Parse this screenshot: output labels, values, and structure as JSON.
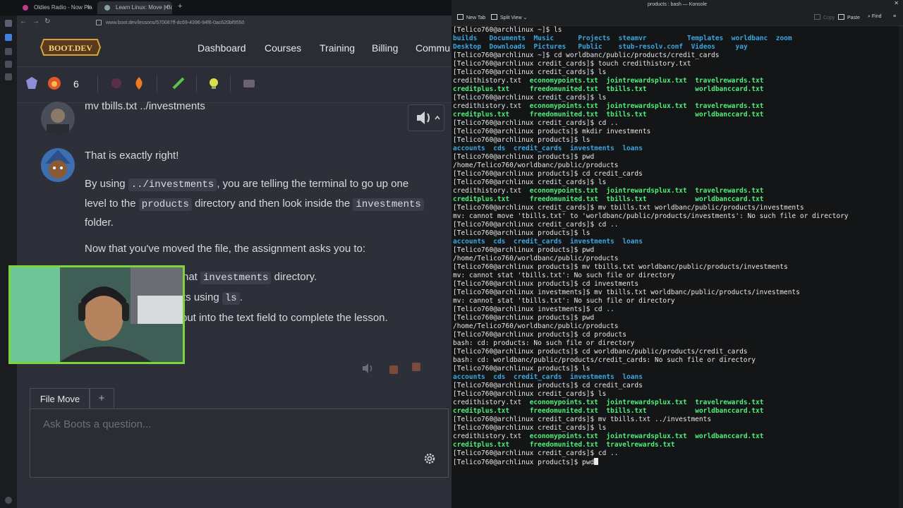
{
  "browser": {
    "tabs": [
      {
        "label": "Oldies Radio - Now Pla",
        "favicon_color": "#c23b8f"
      },
      {
        "label": "Learn Linux: Move | Boot.",
        "favicon_color": "#8a9ca8"
      }
    ],
    "url": "www.boot.dev/lessons/570087ff-dc69-4396-94f6-0ac620bf9550"
  },
  "site": {
    "logo": "BOOT.DEV",
    "nav": [
      "Dashboard",
      "Courses",
      "Training",
      "Billing",
      "Commu"
    ],
    "streak": "6"
  },
  "chat": {
    "user_message": "mv tbills.txt ../investments",
    "bot_line1": "That is exactly right!",
    "bot_p2_a": "By using ",
    "bot_p2_code1": "../investments",
    "bot_p2_b": ", you are telling the terminal to go up one level to the ",
    "bot_p2_code2": "products",
    "bot_p2_c": " directory and then look inside the ",
    "bot_p2_code3": "investments",
    "bot_p2_d": " folder.",
    "bot_p3": "Now that you've moved the file, the assignment asks you to:",
    "bot_li1_a": "hat ",
    "bot_li1_code": "investments",
    "bot_li1_b": " directory.",
    "bot_li2_a": "ts using ",
    "bot_li2_code": "ls",
    "bot_li2_b": ".",
    "bot_li3": "put into the text field to complete the lesson."
  },
  "input": {
    "tab_label": "File Move",
    "add_label": "+",
    "placeholder": "Ask Boots a question..."
  },
  "konsole": {
    "title": "products : bash — Konsole",
    "toolbar": {
      "new_tab": "New Tab",
      "split_view": "Split View",
      "copy": "Copy",
      "paste": "Paste",
      "find": "Find"
    },
    "lines": [
      [
        [
          "p",
          "[Telico760@archlinux ~]$ ls"
        ]
      ],
      [
        [
          "d",
          "builds"
        ],
        [
          "p",
          "   "
        ],
        [
          "d",
          "Documents"
        ],
        [
          "p",
          "  "
        ],
        [
          "d",
          "Music"
        ],
        [
          "p",
          "      "
        ],
        [
          "d",
          "Projects"
        ],
        [
          "p",
          "  "
        ],
        [
          "d",
          "steamvr"
        ],
        [
          "p",
          "          "
        ],
        [
          "d",
          "Templates"
        ],
        [
          "p",
          "  "
        ],
        [
          "d",
          "worldbanc"
        ],
        [
          "p",
          "  "
        ],
        [
          "d",
          "zoom"
        ]
      ],
      [
        [
          "d",
          "Desktop"
        ],
        [
          "p",
          "  "
        ],
        [
          "d",
          "Downloads"
        ],
        [
          "p",
          "  "
        ],
        [
          "d",
          "Pictures"
        ],
        [
          "p",
          "   "
        ],
        [
          "d",
          "Public"
        ],
        [
          "p",
          "    "
        ],
        [
          "d",
          "stub-resolv.conf"
        ],
        [
          "p",
          "  "
        ],
        [
          "d",
          "Videos"
        ],
        [
          "p",
          "     "
        ],
        [
          "d",
          "yay"
        ]
      ],
      [
        [
          "p",
          "[Telico760@archlinux ~]$ cd worldbanc/public/products/credit_cards"
        ]
      ],
      [
        [
          "p",
          "[Telico760@archlinux credit_cards]$ touch credithistory.txt"
        ]
      ],
      [
        [
          "p",
          "[Telico760@archlinux credit_cards]$ ls"
        ]
      ],
      [
        [
          "p",
          "credithistory.txt  "
        ],
        [
          "f",
          "economypoints.txt"
        ],
        [
          "p",
          "  "
        ],
        [
          "f",
          "jointrewardsplux.txt"
        ],
        [
          "p",
          "  "
        ],
        [
          "f",
          "travelrewards.txt"
        ]
      ],
      [
        [
          "f",
          "creditplus.txt"
        ],
        [
          "p",
          "     "
        ],
        [
          "f",
          "freedomunited.txt"
        ],
        [
          "p",
          "  "
        ],
        [
          "f",
          "tbills.txt"
        ],
        [
          "p",
          "            "
        ],
        [
          "f",
          "worldbanccard.txt"
        ]
      ],
      [
        [
          "p",
          "[Telico760@archlinux credit_cards]$ ls"
        ]
      ],
      [
        [
          "p",
          "credithistory.txt  "
        ],
        [
          "f",
          "economypoints.txt"
        ],
        [
          "p",
          "  "
        ],
        [
          "f",
          "jointrewardsplux.txt"
        ],
        [
          "p",
          "  "
        ],
        [
          "f",
          "travelrewards.txt"
        ]
      ],
      [
        [
          "f",
          "creditplus.txt"
        ],
        [
          "p",
          "     "
        ],
        [
          "f",
          "freedomunited.txt"
        ],
        [
          "p",
          "  "
        ],
        [
          "f",
          "tbills.txt"
        ],
        [
          "p",
          "            "
        ],
        [
          "f",
          "worldbanccard.txt"
        ]
      ],
      [
        [
          "p",
          "[Telico760@archlinux credit_cards]$ cd .."
        ]
      ],
      [
        [
          "p",
          "[Telico760@archlinux products]$ mkdir investments"
        ]
      ],
      [
        [
          "p",
          "[Telico760@archlinux products]$ ls"
        ]
      ],
      [
        [
          "d",
          "accounts"
        ],
        [
          "p",
          "  "
        ],
        [
          "d",
          "cds"
        ],
        [
          "p",
          "  "
        ],
        [
          "d",
          "credit_cards"
        ],
        [
          "p",
          "  "
        ],
        [
          "d",
          "investments"
        ],
        [
          "p",
          "  "
        ],
        [
          "d",
          "loans"
        ]
      ],
      [
        [
          "p",
          "[Telico760@archlinux products]$ pwd"
        ]
      ],
      [
        [
          "p",
          "/home/Telico760/worldbanc/public/products"
        ]
      ],
      [
        [
          "p",
          "[Telico760@archlinux products]$ cd credit_cards"
        ]
      ],
      [
        [
          "p",
          "[Telico760@archlinux credit_cards]$ ls"
        ]
      ],
      [
        [
          "p",
          "credithistory.txt  "
        ],
        [
          "f",
          "economypoints.txt"
        ],
        [
          "p",
          "  "
        ],
        [
          "f",
          "jointrewardsplux.txt"
        ],
        [
          "p",
          "  "
        ],
        [
          "f",
          "travelrewards.txt"
        ]
      ],
      [
        [
          "f",
          "creditplus.txt"
        ],
        [
          "p",
          "     "
        ],
        [
          "f",
          "freedomunited.txt"
        ],
        [
          "p",
          "  "
        ],
        [
          "f",
          "tbills.txt"
        ],
        [
          "p",
          "            "
        ],
        [
          "f",
          "worldbanccard.txt"
        ]
      ],
      [
        [
          "p",
          "[Telico760@archlinux credit_cards]$ mv tbills.txt worldbanc/public/products/investments"
        ]
      ],
      [
        [
          "p",
          "mv: cannot move 'tbills.txt' to 'worldbanc/public/products/investments': No such file or directory"
        ]
      ],
      [
        [
          "p",
          "[Telico760@archlinux credit_cards]$ cd .."
        ]
      ],
      [
        [
          "p",
          "[Telico760@archlinux products]$ ls"
        ]
      ],
      [
        [
          "d",
          "accounts"
        ],
        [
          "p",
          "  "
        ],
        [
          "d",
          "cds"
        ],
        [
          "p",
          "  "
        ],
        [
          "d",
          "credit_cards"
        ],
        [
          "p",
          "  "
        ],
        [
          "d",
          "investments"
        ],
        [
          "p",
          "  "
        ],
        [
          "d",
          "loans"
        ]
      ],
      [
        [
          "p",
          "[Telico760@archlinux products]$ pwd"
        ]
      ],
      [
        [
          "p",
          "/home/Telico760/worldbanc/public/products"
        ]
      ],
      [
        [
          "p",
          "[Telico760@archlinux products]$ mv tbills.txt worldbanc/public/products/investments"
        ]
      ],
      [
        [
          "p",
          "mv: cannot stat 'tbills.txt': No such file or directory"
        ]
      ],
      [
        [
          "p",
          "[Telico760@archlinux products]$ cd investments"
        ]
      ],
      [
        [
          "p",
          "[Telico760@archlinux investments]$ mv tbills.txt worldbanc/public/products/investments"
        ]
      ],
      [
        [
          "p",
          "mv: cannot stat 'tbills.txt': No such file or directory"
        ]
      ],
      [
        [
          "p",
          "[Telico760@archlinux investments]$ cd .."
        ]
      ],
      [
        [
          "p",
          "[Telico760@archlinux products]$ pwd"
        ]
      ],
      [
        [
          "p",
          "/home/Telico760/worldbanc/public/products"
        ]
      ],
      [
        [
          "p",
          "[Telico760@archlinux products]$ cd products"
        ]
      ],
      [
        [
          "p",
          "bash: cd: products: No such file or directory"
        ]
      ],
      [
        [
          "p",
          "[Telico760@archlinux products]$ cd worldbanc/public/products/credit_cards"
        ]
      ],
      [
        [
          "p",
          "bash: cd: worldbanc/public/products/credit_cards: No such file or directory"
        ]
      ],
      [
        [
          "p",
          "[Telico760@archlinux products]$ ls"
        ]
      ],
      [
        [
          "d",
          "accounts"
        ],
        [
          "p",
          "  "
        ],
        [
          "d",
          "cds"
        ],
        [
          "p",
          "  "
        ],
        [
          "d",
          "credit_cards"
        ],
        [
          "p",
          "  "
        ],
        [
          "d",
          "investments"
        ],
        [
          "p",
          "  "
        ],
        [
          "d",
          "loans"
        ]
      ],
      [
        [
          "p",
          "[Telico760@archlinux products]$ cd credit_cards"
        ]
      ],
      [
        [
          "p",
          "[Telico760@archlinux credit_cards]$ ls"
        ]
      ],
      [
        [
          "p",
          "credithistory.txt  "
        ],
        [
          "f",
          "economypoints.txt"
        ],
        [
          "p",
          "  "
        ],
        [
          "f",
          "jointrewardsplux.txt"
        ],
        [
          "p",
          "  "
        ],
        [
          "f",
          "travelrewards.txt"
        ]
      ],
      [
        [
          "f",
          "creditplus.txt"
        ],
        [
          "p",
          "     "
        ],
        [
          "f",
          "freedomunited.txt"
        ],
        [
          "p",
          "  "
        ],
        [
          "f",
          "tbills.txt"
        ],
        [
          "p",
          "            "
        ],
        [
          "f",
          "worldbanccard.txt"
        ]
      ],
      [
        [
          "p",
          "[Telico760@archlinux credit_cards]$ mv tbills.txt ../investments"
        ]
      ],
      [
        [
          "p",
          "[Telico760@archlinux credit_cards]$ ls"
        ]
      ],
      [
        [
          "p",
          "credithistory.txt  "
        ],
        [
          "f",
          "economypoints.txt"
        ],
        [
          "p",
          "  "
        ],
        [
          "f",
          "jointrewardsplux.txt"
        ],
        [
          "p",
          "  "
        ],
        [
          "f",
          "worldbanccard.txt"
        ]
      ],
      [
        [
          "f",
          "creditplus.txt"
        ],
        [
          "p",
          "     "
        ],
        [
          "f",
          "freedomunited.txt"
        ],
        [
          "p",
          "  "
        ],
        [
          "f",
          "travelrewards.txt"
        ]
      ],
      [
        [
          "p",
          "[Telico760@archlinux credit_cards]$ cd .."
        ]
      ],
      [
        [
          "p",
          "[Telico760@archlinux products]$ pwd"
        ]
      ]
    ],
    "colors": {
      "dir": "#3aa7e0",
      "exec": "#4ef07a",
      "text": "#e8e8e8",
      "bg": "#141516"
    }
  }
}
